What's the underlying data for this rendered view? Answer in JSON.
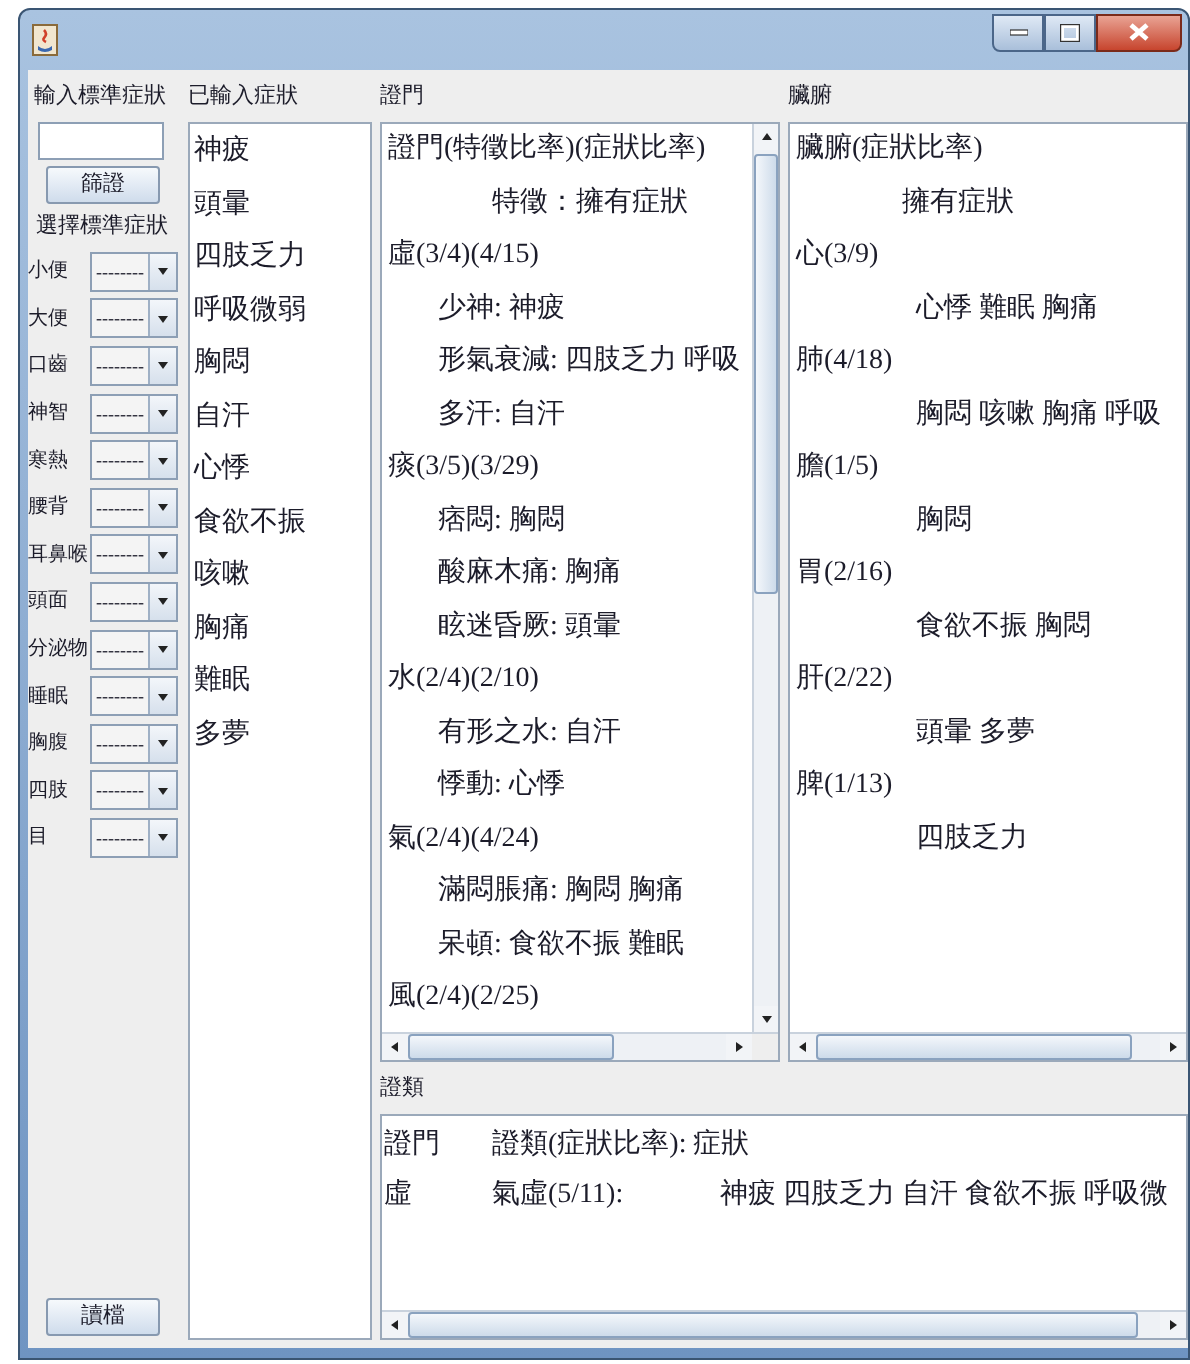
{
  "input_panel": {
    "label": "輸入標準症狀",
    "filter_button": "篩證",
    "select_label": "選擇標準症狀",
    "selectors": [
      {
        "label": "小便",
        "value": "----------"
      },
      {
        "label": "大便",
        "value": "----------"
      },
      {
        "label": "口齒",
        "value": "----------"
      },
      {
        "label": "神智",
        "value": "----------"
      },
      {
        "label": "寒熱",
        "value": "----------"
      },
      {
        "label": "腰背",
        "value": "----------"
      },
      {
        "label": "耳鼻喉",
        "value": "----------"
      },
      {
        "label": "頭面",
        "value": "----------"
      },
      {
        "label": "分泌物",
        "value": "----------"
      },
      {
        "label": "睡眠",
        "value": "----------"
      },
      {
        "label": "胸腹",
        "value": "----------"
      },
      {
        "label": "四肢",
        "value": "----------"
      },
      {
        "label": "目",
        "value": "----------"
      }
    ],
    "load_button": "讀檔"
  },
  "entered_symptoms": {
    "label": "已輸入症狀",
    "items": [
      "神疲",
      "頭暈",
      "四肢乏力",
      "呼吸微弱",
      "胸悶",
      "自汗",
      "心悸",
      "食欲不振",
      "咳嗽",
      "胸痛",
      "難眠",
      "多夢"
    ]
  },
  "syndrome_pane": {
    "label": "證門",
    "lines": [
      {
        "kind": "heading",
        "text": "證門(特徵比率)(症狀比率)"
      },
      {
        "kind": "caption",
        "text": "特徵：擁有症狀"
      },
      {
        "kind": "group",
        "text": "虛(3/4)(4/15)"
      },
      {
        "kind": "item",
        "text": "少神: 神疲"
      },
      {
        "kind": "item",
        "text": "形氣衰減: 四肢乏力 呼吸"
      },
      {
        "kind": "item",
        "text": "多汗: 自汗"
      },
      {
        "kind": "group",
        "text": "痰(3/5)(3/29)"
      },
      {
        "kind": "item",
        "text": "痞悶: 胸悶"
      },
      {
        "kind": "item",
        "text": "酸麻木痛: 胸痛"
      },
      {
        "kind": "item",
        "text": "眩迷昏厥: 頭暈"
      },
      {
        "kind": "group",
        "text": "水(2/4)(2/10)"
      },
      {
        "kind": "item",
        "text": "有形之水: 自汗"
      },
      {
        "kind": "item",
        "text": "悸動: 心悸"
      },
      {
        "kind": "group",
        "text": "氣(2/4)(4/24)"
      },
      {
        "kind": "item",
        "text": "滿悶脹痛: 胸悶 胸痛"
      },
      {
        "kind": "item",
        "text": "呆頓: 食欲不振 難眠"
      },
      {
        "kind": "group",
        "text": "風(2/4)(2/25)"
      }
    ]
  },
  "organ_pane": {
    "label": "臟腑",
    "lines": [
      {
        "kind": "heading",
        "text": "臟腑(症狀比率)"
      },
      {
        "kind": "caption",
        "text": "擁有症狀"
      },
      {
        "kind": "group",
        "text": "心(3/9)"
      },
      {
        "kind": "item",
        "text": "心悸 難眠 胸痛"
      },
      {
        "kind": "group",
        "text": "肺(4/18)"
      },
      {
        "kind": "item",
        "text": "胸悶 咳嗽 胸痛 呼吸"
      },
      {
        "kind": "group",
        "text": "膽(1/5)"
      },
      {
        "kind": "item",
        "text": "胸悶"
      },
      {
        "kind": "group",
        "text": "胃(2/16)"
      },
      {
        "kind": "item",
        "text": "食欲不振 胸悶"
      },
      {
        "kind": "group",
        "text": "肝(2/22)"
      },
      {
        "kind": "item",
        "text": "頭暈 多夢"
      },
      {
        "kind": "group",
        "text": "脾(1/13)"
      },
      {
        "kind": "item",
        "text": "四肢乏力"
      }
    ]
  },
  "category_pane": {
    "label": "證類",
    "rows": [
      {
        "cells": [
          "證門",
          "證類(症狀比率): 症狀"
        ]
      },
      {
        "cells": [
          "虛",
          "氣虛(5/11):",
          "神疲 四肢乏力 自汗 食欲不振 呼吸微"
        ]
      }
    ]
  }
}
